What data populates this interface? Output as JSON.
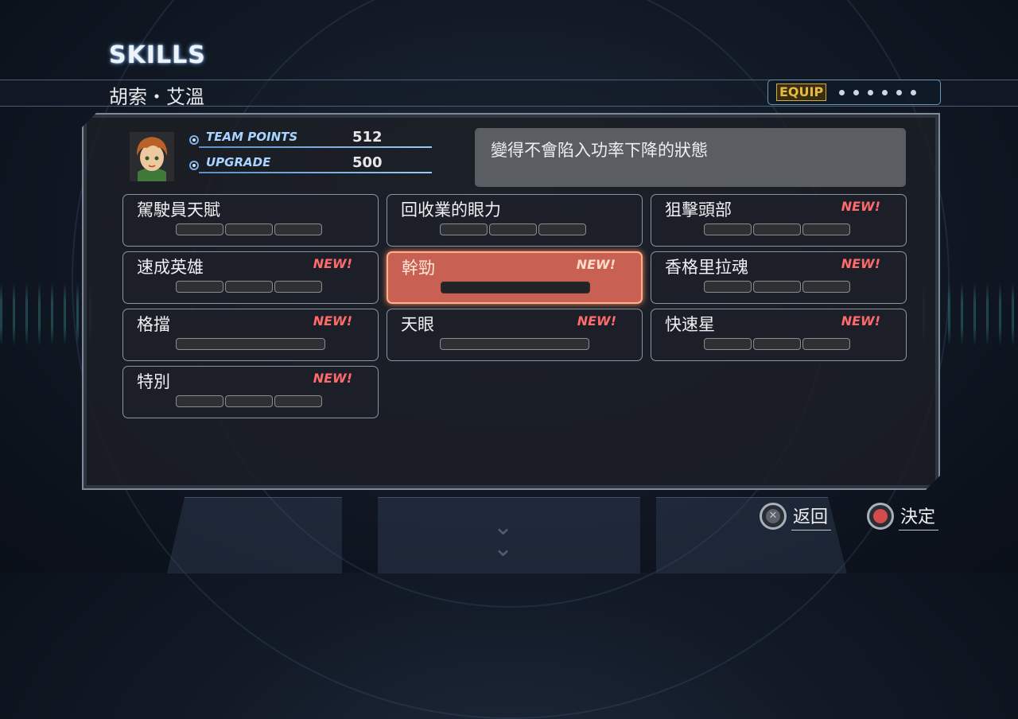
{
  "screen_title": "SKILLS",
  "pilot_name": "胡索・艾溫",
  "equip_label": "EQUIP",
  "equip_dots": 6,
  "stats": [
    {
      "label": "TEAM POINTS",
      "value": "512"
    },
    {
      "label": "UPGRADE",
      "value": "500"
    }
  ],
  "description": "變得不會陷入功率下降的狀態",
  "skills": [
    {
      "name": "駕駛員天賦",
      "new": "",
      "segments": 3,
      "long_bar": false
    },
    {
      "name": "回收業的眼力",
      "new": "",
      "segments": 3,
      "long_bar": false
    },
    {
      "name": "狙擊頭部",
      "new": "NEW!",
      "segments": 3,
      "long_bar": false
    },
    {
      "name": "速成英雄",
      "new": "NEW!",
      "segments": 3,
      "long_bar": false
    },
    {
      "name": "幹勁",
      "new": "NEW!",
      "segments": 1,
      "long_bar": true,
      "selected": true
    },
    {
      "name": "香格里拉魂",
      "new": "NEW!",
      "segments": 3,
      "long_bar": false
    },
    {
      "name": "格擋",
      "new": "NEW!",
      "segments": 1,
      "long_bar": true
    },
    {
      "name": "天眼",
      "new": "NEW!",
      "segments": 1,
      "long_bar": true
    },
    {
      "name": "快速星",
      "new": "NEW!",
      "segments": 3,
      "long_bar": false
    },
    {
      "name": "特別",
      "new": "NEW!",
      "segments": 3,
      "long_bar": false
    }
  ],
  "buttons": {
    "back": {
      "glyph": "✕",
      "label": "返回"
    },
    "confirm": {
      "glyph": "",
      "label": "決定"
    }
  },
  "colors": {
    "selected_skill": "#c96054",
    "new_badge": "#ff6a6a",
    "equip": "#e8b840"
  }
}
